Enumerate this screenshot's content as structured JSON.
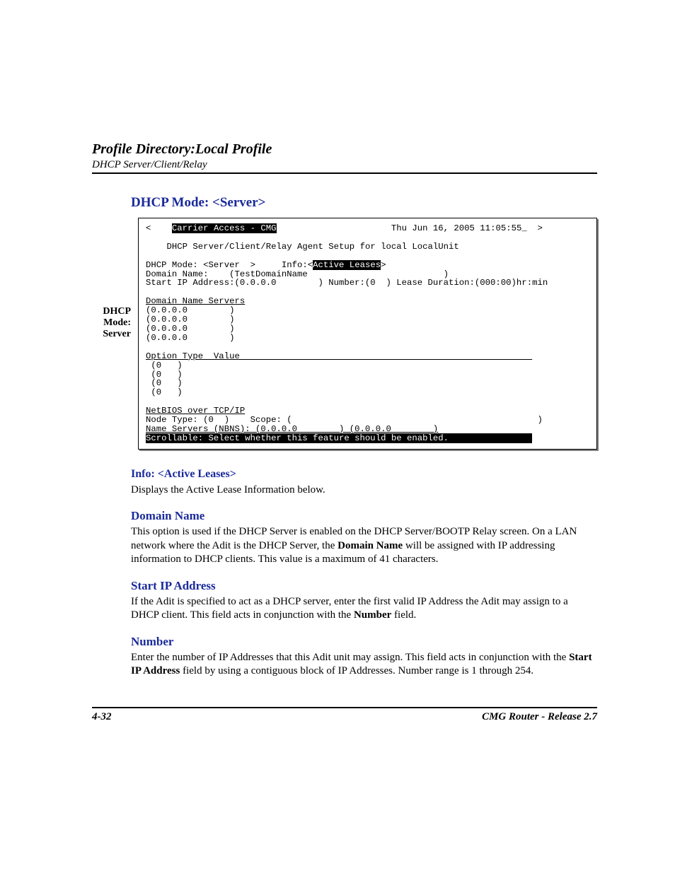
{
  "header": {
    "title": "Profile Directory:Local Profile",
    "subtitle": "DHCP Server/Client/Relay"
  },
  "section_heading": "DHCP Mode: <Server>",
  "side_label": {
    "l1": "DHCP",
    "l2": "Mode:",
    "l3": "Server"
  },
  "terminal": {
    "title_left": "Carrier Access - CMG",
    "title_right": "Thu Jun 16, 2005 11:05:55_",
    "subtitle": "DHCP Server/Client/Relay Agent Setup for local LocalUnit",
    "mode_label": "DHCP Mode: <Server  >",
    "info_label": "Info:<",
    "info_value": "Active Leases",
    "info_close": ">",
    "domain_name_line": "Domain Name:    (TestDomainName                          )",
    "start_ip_line": "Start IP Address:(0.0.0.0        ) Number:(0  ) Lease Duration:(000:00)hr:min",
    "dns_heading": "Domain Name Servers",
    "dns1": "(0.0.0.0        )",
    "dns2": "(0.0.0.0        )",
    "dns3": "(0.0.0.0        )",
    "dns4": "(0.0.0.0        )",
    "option_heading": "Option Type  Value                                                        ",
    "opt1": " (0   )",
    "opt2": " (0   )",
    "opt3": " (0   )",
    "opt4": " (0   )",
    "netbios_heading": "NetBIOS over TCP/IP",
    "node_line": "Node Type: (0  )    Scope: (                                               )",
    "nbns_line": "Name Servers (NBNS): (0.0.0.0        ) (0.0.0.0        )",
    "status_line": "Scrollable: Select whether this feature should be enabled.                "
  },
  "info_section": {
    "heading": "Info: <Active Leases>",
    "text": "Displays the Active Lease Information below."
  },
  "domain_section": {
    "heading": "Domain Name",
    "t1": "This option is used if the DHCP Server is enabled on the DHCP Server/BOOTP Relay screen. On a LAN network where the Adit is the DHCP Server, the ",
    "bold": "Domain Name",
    "t2": " will be assigned with IP addressing information to DHCP clients. This value is a maximum of 41 characters."
  },
  "startip_section": {
    "heading": "Start IP Address",
    "t1": "If the Adit is specified to act as a DHCP server, enter the first valid IP Address the Adit may assign to a DHCP client. This field acts in conjunction with the ",
    "bold": "Number",
    "t2": " field."
  },
  "number_section": {
    "heading": "Number",
    "t1": "Enter the number of IP Addresses that this Adit unit may assign. This field acts in conjunction with the ",
    "bold": "Start IP Address",
    "t2": " field by using a contiguous block of IP Addresses. Number range is 1 through 254."
  },
  "footer": {
    "page": "4-32",
    "right": "CMG Router - Release 2.7"
  }
}
